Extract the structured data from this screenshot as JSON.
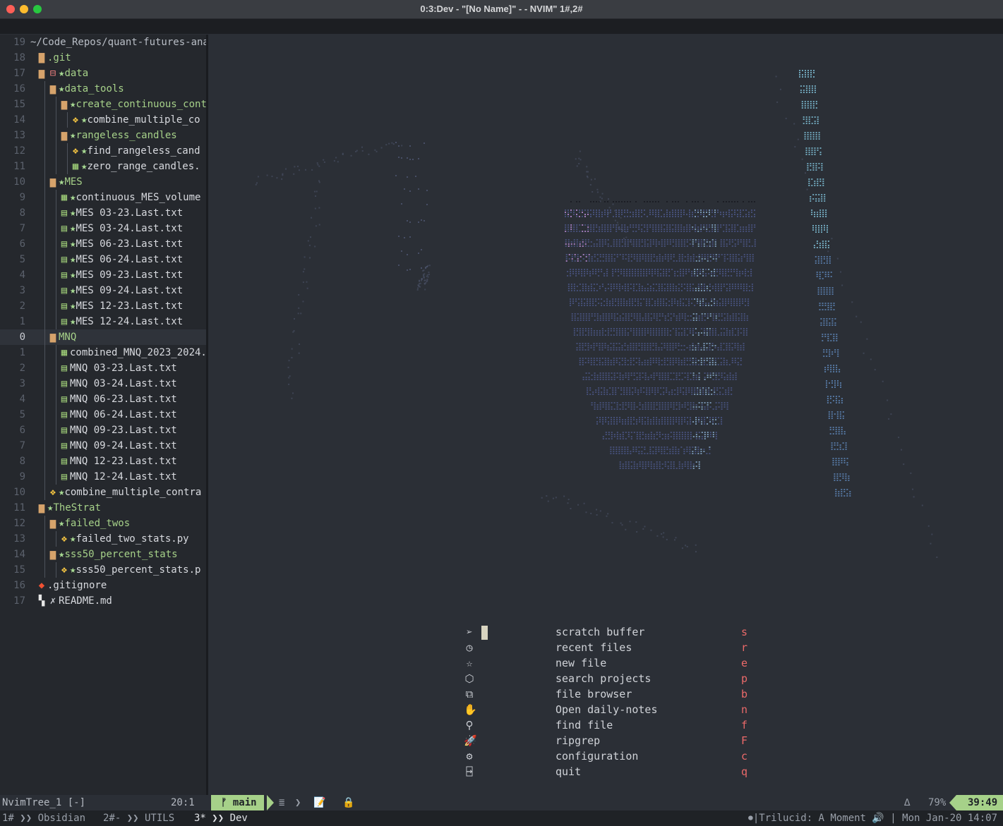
{
  "window": {
    "title": "0:3:Dev - \"[No Name]\" - - NVIM\" 1#,2#"
  },
  "tree": [
    {
      "num": "19",
      "indent": 0,
      "icon": "",
      "kind": "root",
      "star": false,
      "label": "~/Code_Repos/quant-futures-anal"
    },
    {
      "num": "18",
      "indent": 0,
      "icon": "folder",
      "kind": "folder",
      "star": false,
      "label": ".git"
    },
    {
      "num": "17",
      "indent": 0,
      "icon": "folder-open",
      "kind": "folder",
      "star": true,
      "label": "data",
      "box": true
    },
    {
      "num": "16",
      "indent": 1,
      "icon": "folder-open",
      "kind": "folder",
      "star": true,
      "label": "data_tools"
    },
    {
      "num": "15",
      "indent": 2,
      "icon": "folder-open",
      "kind": "folder",
      "star": true,
      "label": "create_continuous_cont"
    },
    {
      "num": "14",
      "indent": 3,
      "icon": "python",
      "kind": "file",
      "star": true,
      "label": "combine_multiple_co",
      "last": true
    },
    {
      "num": "13",
      "indent": 2,
      "icon": "folder-open",
      "kind": "folder",
      "star": true,
      "label": "rangeless_candles"
    },
    {
      "num": "12",
      "indent": 3,
      "icon": "python",
      "kind": "file",
      "star": true,
      "label": "find_rangeless_cand"
    },
    {
      "num": "11",
      "indent": 3,
      "icon": "csv",
      "kind": "file",
      "star": true,
      "label": "zero_range_candles.",
      "last": true
    },
    {
      "num": "10",
      "indent": 1,
      "icon": "folder-open",
      "kind": "folder",
      "star": true,
      "label": "MES"
    },
    {
      "num": "9",
      "indent": 2,
      "icon": "csv",
      "kind": "file",
      "star": true,
      "label": "continuous_MES_volume"
    },
    {
      "num": "8",
      "indent": 2,
      "icon": "file",
      "kind": "file",
      "star": true,
      "label": "MES 03-23.Last.txt"
    },
    {
      "num": "7",
      "indent": 2,
      "icon": "file",
      "kind": "file",
      "star": true,
      "label": "MES 03-24.Last.txt"
    },
    {
      "num": "6",
      "indent": 2,
      "icon": "file",
      "kind": "file",
      "star": true,
      "label": "MES 06-23.Last.txt"
    },
    {
      "num": "5",
      "indent": 2,
      "icon": "file",
      "kind": "file",
      "star": true,
      "label": "MES 06-24.Last.txt"
    },
    {
      "num": "4",
      "indent": 2,
      "icon": "file",
      "kind": "file",
      "star": true,
      "label": "MES 09-23.Last.txt"
    },
    {
      "num": "3",
      "indent": 2,
      "icon": "file",
      "kind": "file",
      "star": true,
      "label": "MES 09-24.Last.txt"
    },
    {
      "num": "2",
      "indent": 2,
      "icon": "file",
      "kind": "file",
      "star": true,
      "label": "MES 12-23.Last.txt"
    },
    {
      "num": "1",
      "indent": 2,
      "icon": "file",
      "kind": "file",
      "star": true,
      "label": "MES 12-24.Last.txt",
      "last": true
    },
    {
      "num": "0",
      "indent": 1,
      "icon": "folder-open",
      "kind": "folder",
      "star": false,
      "label": "MNQ",
      "current": true
    },
    {
      "num": "1",
      "indent": 2,
      "icon": "csv",
      "kind": "file",
      "star": false,
      "label": "combined_MNQ_2023_2024."
    },
    {
      "num": "2",
      "indent": 2,
      "icon": "file",
      "kind": "file",
      "star": false,
      "label": "MNQ 03-23.Last.txt"
    },
    {
      "num": "3",
      "indent": 2,
      "icon": "file",
      "kind": "file",
      "star": false,
      "label": "MNQ 03-24.Last.txt"
    },
    {
      "num": "4",
      "indent": 2,
      "icon": "file",
      "kind": "file",
      "star": false,
      "label": "MNQ 06-23.Last.txt"
    },
    {
      "num": "5",
      "indent": 2,
      "icon": "file",
      "kind": "file",
      "star": false,
      "label": "MNQ 06-24.Last.txt"
    },
    {
      "num": "6",
      "indent": 2,
      "icon": "file",
      "kind": "file",
      "star": false,
      "label": "MNQ 09-23.Last.txt"
    },
    {
      "num": "7",
      "indent": 2,
      "icon": "file",
      "kind": "file",
      "star": false,
      "label": "MNQ 09-24.Last.txt"
    },
    {
      "num": "8",
      "indent": 2,
      "icon": "file",
      "kind": "file",
      "star": false,
      "label": "MNQ 12-23.Last.txt"
    },
    {
      "num": "9",
      "indent": 2,
      "icon": "file",
      "kind": "file",
      "star": false,
      "label": "MNQ 12-24.Last.txt",
      "last": true
    },
    {
      "num": "10",
      "indent": 1,
      "icon": "python",
      "kind": "file",
      "star": true,
      "label": "combine_multiple_contra",
      "last": true
    },
    {
      "num": "11",
      "indent": 0,
      "icon": "folder-open",
      "kind": "folder",
      "star": true,
      "label": "TheStrat"
    },
    {
      "num": "12",
      "indent": 1,
      "icon": "folder-open",
      "kind": "folder",
      "star": true,
      "label": "failed_twos"
    },
    {
      "num": "13",
      "indent": 2,
      "icon": "python",
      "kind": "file",
      "star": true,
      "label": "failed_two_stats.py",
      "last": true
    },
    {
      "num": "14",
      "indent": 1,
      "icon": "folder-open",
      "kind": "folder",
      "star": true,
      "label": "sss50_percent_stats"
    },
    {
      "num": "15",
      "indent": 2,
      "icon": "python",
      "kind": "file",
      "star": true,
      "label": "sss50_percent_stats.p",
      "last": true
    },
    {
      "num": "16",
      "indent": 0,
      "icon": "git",
      "kind": "file",
      "star": false,
      "label": ".gitignore"
    },
    {
      "num": "17",
      "indent": 0,
      "icon": "markdown",
      "kind": "file",
      "star": false,
      "label": "README.md",
      "mark": "✗"
    }
  ],
  "dashboard": {
    "items": [
      {
        "icon": "paper-plane-icon",
        "glyph": "➢",
        "label": "scratch buffer",
        "key": "s"
      },
      {
        "icon": "clock-icon",
        "glyph": "◷",
        "label": "recent files",
        "key": "r"
      },
      {
        "icon": "star-icon",
        "glyph": "☆",
        "label": "new file",
        "key": "e"
      },
      {
        "icon": "cube-icon",
        "glyph": "⬡",
        "label": "search projects",
        "key": "p"
      },
      {
        "icon": "copy-icon",
        "glyph": "⧉",
        "label": "file browser",
        "key": "b"
      },
      {
        "icon": "hand-icon",
        "glyph": "✋",
        "label": "Open daily-notes",
        "key": "n"
      },
      {
        "icon": "magnifier-icon",
        "glyph": "⚲",
        "label": "find file",
        "key": "f"
      },
      {
        "icon": "rocket-icon",
        "glyph": "🚀",
        "label": "ripgrep",
        "key": "F"
      },
      {
        "icon": "gear-icon",
        "glyph": "⚙",
        "label": "configuration",
        "key": "c"
      },
      {
        "icon": "exit-icon",
        "glyph": "⍈",
        "label": "quit",
        "key": "q"
      }
    ]
  },
  "statusline": {
    "left": "NvimTree_1 [-]",
    "position": "20:1",
    "branch_icon": "ᚠ",
    "branch": "main",
    "lines_icon": "≣",
    "chevron": "❯",
    "pencil": "📝",
    "lock": "🔒",
    "warn": "∆",
    "percent": "79%",
    "time": "39:49"
  },
  "tmux": {
    "windows": [
      {
        "label": "1# ❯❯ Obsidian",
        "active": false
      },
      {
        "label": "2#- ❯❯ UTILS",
        "active": false
      },
      {
        "label": "3* ❯❯ Dev",
        "active": true
      }
    ],
    "right": "⏺|Trilucid: A Moment 🔊 | Mon Jan-20 14:07"
  }
}
